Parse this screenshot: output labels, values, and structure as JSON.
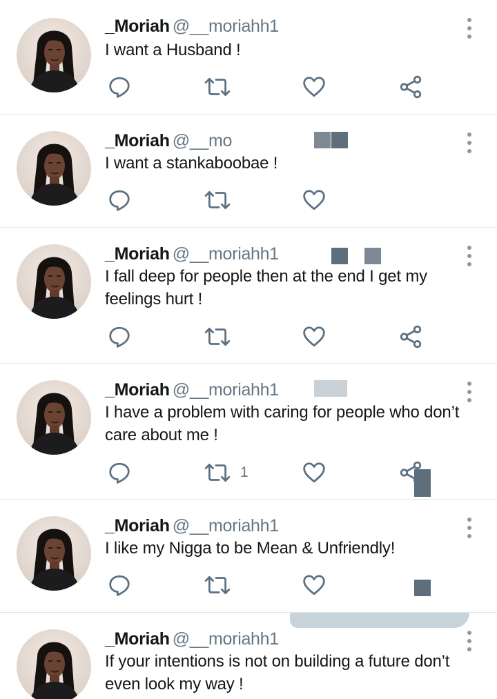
{
  "user": {
    "display_name": "_Moriah",
    "handle": "@__moriahh1"
  },
  "colors": {
    "text": "#14171a",
    "secondary": "#657786",
    "icon": "#5b7083",
    "divider": "#e1e6ea"
  },
  "icons": {
    "reply": "speech-bubble-icon",
    "retweet": "retweet-arrows-icon",
    "like": "heart-icon",
    "share": "share-nodes-icon",
    "more": "vertical-dots-icon"
  },
  "tweets": [
    {
      "name": "_Moriah",
      "handle": "@__moriahh1",
      "text": "I want a Husband !",
      "retweets": ""
    },
    {
      "name": "_Moriah",
      "handle": "@__mo",
      "text": "I want a stankaboobae !",
      "retweets": ""
    },
    {
      "name": "_Moriah",
      "handle": "@__moriahh1",
      "text": "I fall deep for people then at the end I get my feelings hurt !",
      "retweets": ""
    },
    {
      "name": "_Moriah",
      "handle": "@__moriahh1",
      "text": "I have a problem with caring for people who don’t care about me !",
      "retweets": "1"
    },
    {
      "name": "_Moriah",
      "handle": "@__moriahh1",
      "text": "I like my Nigga to be Mean & Unfriendly!",
      "retweets": ""
    },
    {
      "name": "_Moriah",
      "handle": "@__moriahh1",
      "text": "If your intentions is not on building a future don’t even look my way !",
      "retweets": ""
    }
  ]
}
